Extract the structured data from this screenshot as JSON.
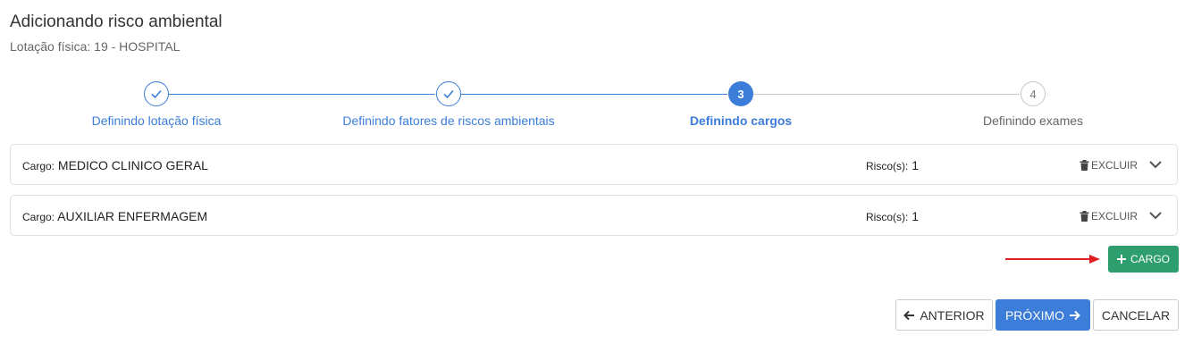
{
  "header": {
    "title": "Adicionando risco ambiental",
    "subtitle": "Lotação física: 19 - HOSPITAL"
  },
  "stepper": {
    "steps": [
      {
        "number": "1",
        "label": "Definindo lotação física",
        "state": "done"
      },
      {
        "number": "2",
        "label": "Definindo fatores de riscos ambientais",
        "state": "done"
      },
      {
        "number": "3",
        "label": "Definindo cargos",
        "state": "active"
      },
      {
        "number": "4",
        "label": "Definindo exames",
        "state": "todo"
      }
    ]
  },
  "cargos": [
    {
      "cargo_label": "Cargo:",
      "cargo_value": "MEDICO CLINICO GERAL",
      "risco_label": "Risco(s):",
      "risco_value": "1",
      "excluir_label": "EXCLUIR"
    },
    {
      "cargo_label": "Cargo:",
      "cargo_value": "AUXILIAR ENFERMAGEM",
      "risco_label": "Risco(s):",
      "risco_value": "1",
      "excluir_label": "EXCLUIR"
    }
  ],
  "actions": {
    "add_cargo_label": "CARGO",
    "anterior_label": "ANTERIOR",
    "proximo_label": "PRÓXIMO",
    "cancelar_label": "CANCELAR"
  },
  "colors": {
    "primary": "#3b7dd8",
    "success": "#2e9e6e",
    "annotation_arrow": "#e02020"
  },
  "icons": [
    "check-icon",
    "trash-icon",
    "chevron-down-icon",
    "plus-icon",
    "arrow-left-icon",
    "arrow-right-icon"
  ]
}
